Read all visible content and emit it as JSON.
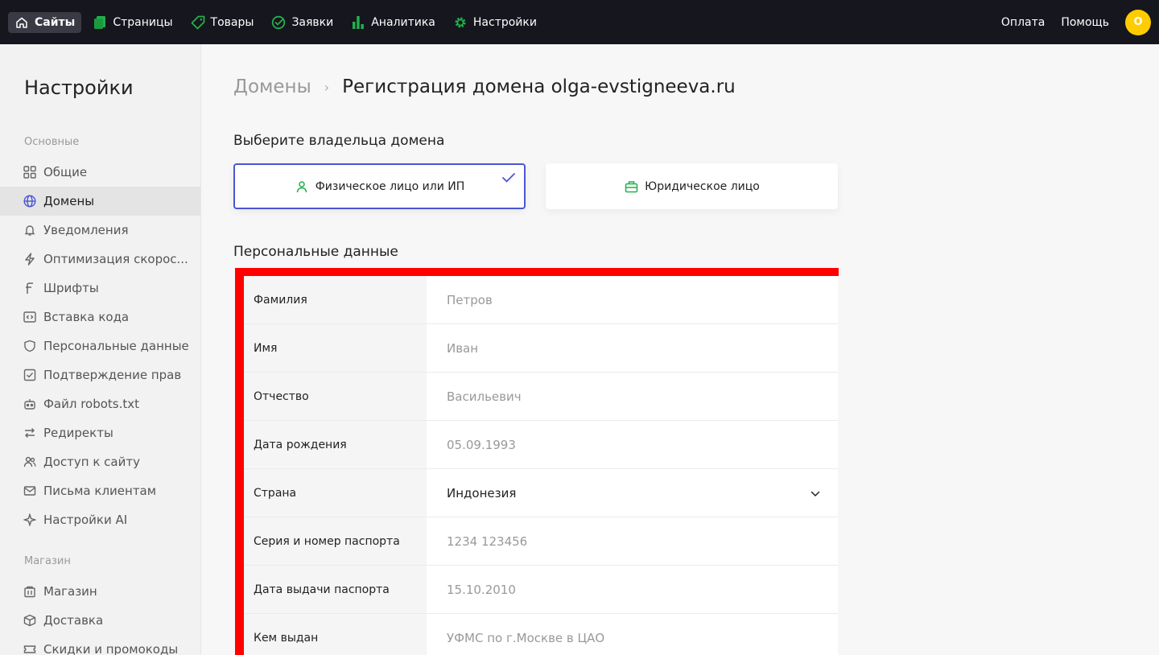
{
  "topnav": {
    "items": [
      {
        "label": "Сайты",
        "icon": "home-icon"
      },
      {
        "label": "Страницы",
        "icon": "pages-icon"
      },
      {
        "label": "Товары",
        "icon": "tag-icon"
      },
      {
        "label": "Заявки",
        "icon": "requests-icon"
      },
      {
        "label": "Аналитика",
        "icon": "analytics-icon"
      },
      {
        "label": "Настройки",
        "icon": "gear-icon"
      }
    ],
    "payment": "Оплата",
    "help": "Помощь",
    "avatar_letter": "O"
  },
  "sidebar": {
    "title": "Настройки",
    "group_main": "Основные",
    "group_shop": "Магазин",
    "items": [
      {
        "label": "Общие",
        "icon": "grid-icon"
      },
      {
        "label": "Домены",
        "icon": "globe-icon"
      },
      {
        "label": "Уведомления",
        "icon": "bell-icon"
      },
      {
        "label": "Оптимизация скорос...",
        "icon": "lightning-icon"
      },
      {
        "label": "Шрифты",
        "icon": "font-icon"
      },
      {
        "label": "Вставка кода",
        "icon": "code-icon"
      },
      {
        "label": "Персональные данные",
        "icon": "shield-icon"
      },
      {
        "label": "Подтверждение прав",
        "icon": "checkbox-icon"
      },
      {
        "label": "Файл robots.txt",
        "icon": "robot-icon"
      },
      {
        "label": "Редиректы",
        "icon": "redirect-icon"
      },
      {
        "label": "Доступ к сайту",
        "icon": "users-icon"
      },
      {
        "label": "Письма клиентам",
        "icon": "mail-icon"
      },
      {
        "label": "Настройки AI",
        "icon": "ai-icon"
      }
    ],
    "shop_items": [
      {
        "label": "Магазин",
        "icon": "store-icon"
      },
      {
        "label": "Доставка",
        "icon": "box-icon"
      },
      {
        "label": "Скидки и промокоды",
        "icon": "ticket-icon"
      }
    ]
  },
  "main": {
    "breadcrumb_parent": "Домены",
    "breadcrumb_current": "Регистрация домена olga-evstigneeva.ru",
    "owner_heading": "Выберите владельца домена",
    "owner_individual": "Физическое лицо или ИП",
    "owner_company": "Юридическое лицо",
    "personal_heading": "Персональные данные",
    "fields": [
      {
        "label": "Фамилия",
        "placeholder": "Петров"
      },
      {
        "label": "Имя",
        "placeholder": "Иван"
      },
      {
        "label": "Отчество",
        "placeholder": "Васильевич"
      },
      {
        "label": "Дата рождения",
        "placeholder": "05.09.1993"
      },
      {
        "label": "Страна",
        "value": "Индонезия"
      },
      {
        "label": "Серия и номер паспорта",
        "placeholder": "1234 123456"
      },
      {
        "label": "Дата выдачи паспорта",
        "placeholder": "15.10.2010"
      },
      {
        "label": "Кем выдан",
        "placeholder": "УФМС по г.Москве в ЦАО"
      }
    ]
  },
  "colors": {
    "topbar": "#16161e",
    "accent_green": "#22b04b",
    "selected_border": "#4b55d6",
    "avatar": "#ffcc00",
    "highlight_red": "#ff0000"
  }
}
